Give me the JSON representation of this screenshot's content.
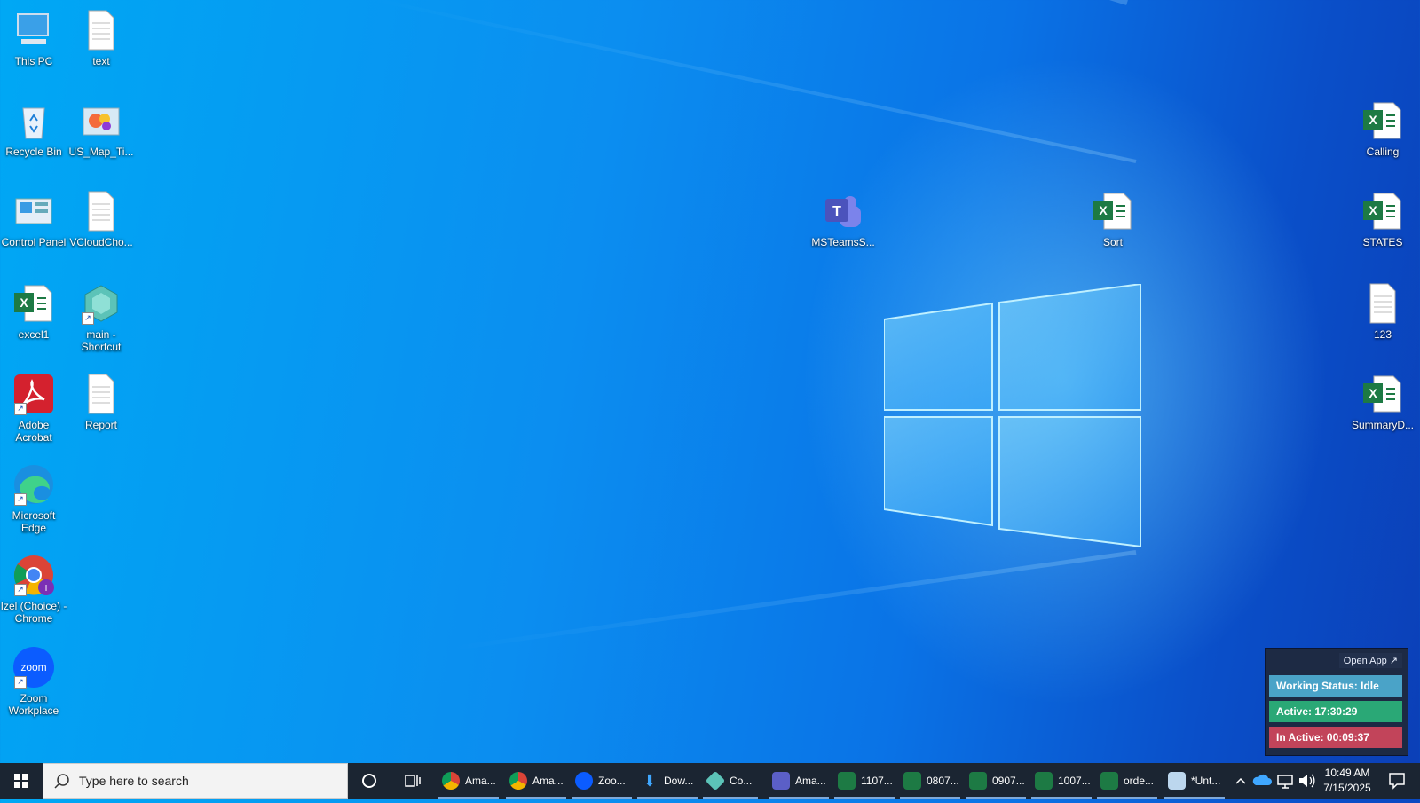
{
  "desktop_icons": [
    {
      "id": "this-pc",
      "label": "This PC"
    },
    {
      "id": "text",
      "label": "text"
    },
    {
      "id": "recycle-bin",
      "label": "Recycle Bin"
    },
    {
      "id": "us-map",
      "label": "US_Map_Ti..."
    },
    {
      "id": "control-panel",
      "label": "Control Panel"
    },
    {
      "id": "vcloud",
      "label": "VCloudCho..."
    },
    {
      "id": "excel1",
      "label": "excel1"
    },
    {
      "id": "main-shortcut",
      "label": "main - Shortcut"
    },
    {
      "id": "adobe",
      "label": "Adobe Acrobat"
    },
    {
      "id": "report",
      "label": "Report"
    },
    {
      "id": "edge",
      "label": "Microsoft Edge"
    },
    {
      "id": "chrome",
      "label": "Izel (Choice) - Chrome"
    },
    {
      "id": "zoom",
      "label": "Zoom Workplace"
    },
    {
      "id": "msteams",
      "label": "MSTeamsS..."
    },
    {
      "id": "sort",
      "label": "Sort"
    },
    {
      "id": "calling",
      "label": "Calling"
    },
    {
      "id": "states",
      "label": "STATES"
    },
    {
      "id": "file-123",
      "label": "123"
    },
    {
      "id": "summary",
      "label": "SummaryD..."
    }
  ],
  "widget": {
    "open_app": "Open App ↗",
    "status": "Working Status: Idle",
    "active": "Active: 17:30:29",
    "inactive": "In Active: 00:09:37",
    "colors": {
      "status": "#4aa3c8",
      "active": "#2aa876",
      "inactive": "#c2445a"
    }
  },
  "taskbar": {
    "search_placeholder": "Type here to search",
    "apps": [
      {
        "label": "Ama...",
        "icon": "chrome-icon"
      },
      {
        "label": "Ama...",
        "icon": "chrome-icon"
      },
      {
        "label": "Zoo...",
        "icon": "zoom-icon"
      },
      {
        "label": "Dow...",
        "icon": "download-icon"
      },
      {
        "label": "Co...",
        "icon": "app-icon"
      },
      {
        "label": "Ama...",
        "icon": "teams-icon"
      },
      {
        "label": "1107...",
        "icon": "excel-icon"
      },
      {
        "label": "0807...",
        "icon": "excel-icon"
      },
      {
        "label": "0907...",
        "icon": "excel-icon"
      },
      {
        "label": "1007...",
        "icon": "excel-icon"
      },
      {
        "label": "orde...",
        "icon": "excel-icon"
      },
      {
        "label": "*Unt...",
        "icon": "notepad-icon"
      }
    ],
    "time": "10:49 AM",
    "date": "7/15/2025"
  }
}
